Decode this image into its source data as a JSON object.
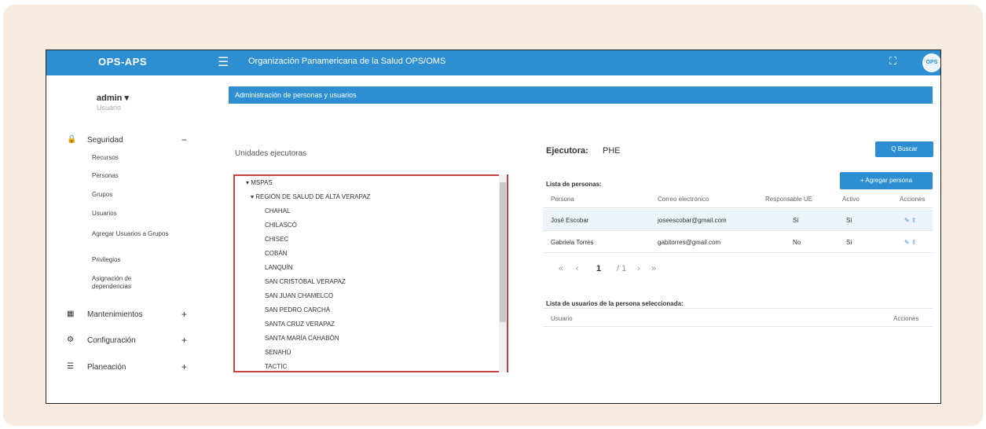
{
  "topbar": {
    "brand": "OPS-APS",
    "menu_icon": "☰",
    "title": "Organización Panamericana de la Salud  OPS/OMS",
    "fullscreen_icon": "⛶",
    "logo_text": "OPS"
  },
  "sidebar": {
    "user_name": "admin ▾",
    "user_role": "Usuario",
    "sections": [
      {
        "icon": "🔒",
        "label": "Seguridad",
        "toggle": "−"
      },
      {
        "icon": "▦",
        "label": "Mantenimientos",
        "toggle": "+"
      },
      {
        "icon": "⚙",
        "label": "Configuración",
        "toggle": "+"
      },
      {
        "icon": "☰",
        "label": "Planeación",
        "toggle": "+"
      }
    ],
    "security_items": [
      "Recursos",
      "Personas",
      "Grupos",
      "Usuarios",
      "Agregar Usuarios a Grupos",
      "Privilegios",
      "Asignación de dependencias"
    ]
  },
  "main": {
    "header": "Administración de personas y usuarios",
    "search_button": "Q Buscar",
    "units_label": "Unidades ejecutoras",
    "tree": [
      "▾ MSPAS",
      "▾ REGIÓN DE SALUD DE ALTA VERAPAZ",
      "CHAHAL",
      "CHILASCÓ",
      "CHISEC",
      "COBÁN",
      "LANQUÍN",
      "SAN CRISTÓBAL VERAPAZ",
      "SAN JUAN CHAMELCO",
      "SAN PEDRO CARCHÁ",
      "SANTA CRUZ VERAPAZ",
      "SANTA MARÍA CAHABÓN",
      "SENAHÚ",
      "TACTIC"
    ],
    "ejecutora_label": "Ejecutora:",
    "ejecutora_value": "PHE",
    "personas_label": "Lista de personas:",
    "add_person_button": "+ Agregar persona",
    "columns": [
      "Persona",
      "Correo electrónico",
      "Responsable UE",
      "Activo",
      "Acciones"
    ],
    "rows": [
      {
        "persona": "José Escobar",
        "correo": "joseescobar@gmail.com",
        "responsable": "Sí",
        "activo": "Sí",
        "acciones": "✎ ⇪"
      },
      {
        "persona": "Gabriela Torres",
        "correo": "gabitorres@gmail.com",
        "responsable": "No",
        "activo": "Sí",
        "acciones": "✎ ⇪"
      }
    ],
    "pager": {
      "first": "«",
      "prev": "‹",
      "page": "1",
      "total": "/ 1",
      "next": "›",
      "last": "»"
    },
    "usuarios_label": "Lista de usuarios de la persona seleccionada:",
    "usuarios_columns": [
      "Usuario",
      "Acciones"
    ]
  }
}
